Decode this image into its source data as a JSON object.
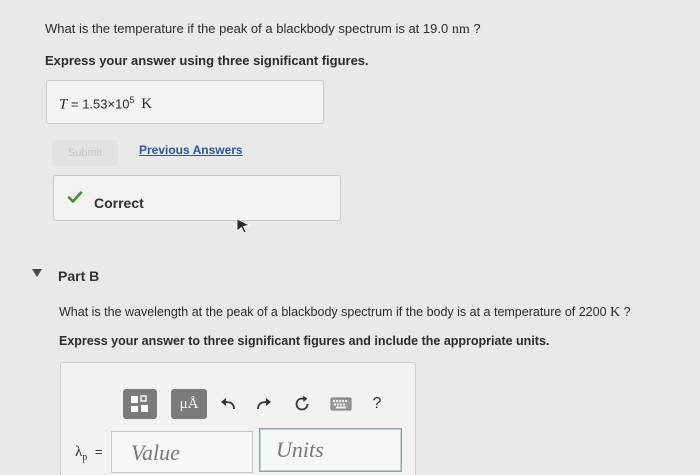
{
  "part_a": {
    "question_prefix": "What is the temperature if the peak of a blackbody spectrum is at 19.0",
    "question_unit": "nm",
    "question_suffix": "?",
    "instruction": "Express your answer using three significant figures.",
    "answer_var": "T",
    "answer_eq": "=",
    "answer_mantissa": "1.53×10",
    "answer_exp": "5",
    "answer_unit": "K",
    "submit_label": "Submit",
    "previous_answers_label": "Previous Answers",
    "correct_label": "Correct"
  },
  "part_b": {
    "title": "Part B",
    "question_prefix": "What is the wavelength at the peak of a blackbody spectrum if the body is at a temperature of 2200",
    "question_unit": "K",
    "question_suffix": "?",
    "instruction": "Express your answer to three significant figures and include the appropriate units.",
    "toolbar": {
      "units_symbol": "μÅ",
      "help_label": "?"
    },
    "lambda_symbol": "λ",
    "lambda_sub": "p",
    "eq": "=",
    "value_placeholder": "Value",
    "units_placeholder": "Units"
  },
  "colors": {
    "link": "#2a58a6",
    "check_green": "#3f8f2c",
    "background": "#e9e9e7"
  }
}
